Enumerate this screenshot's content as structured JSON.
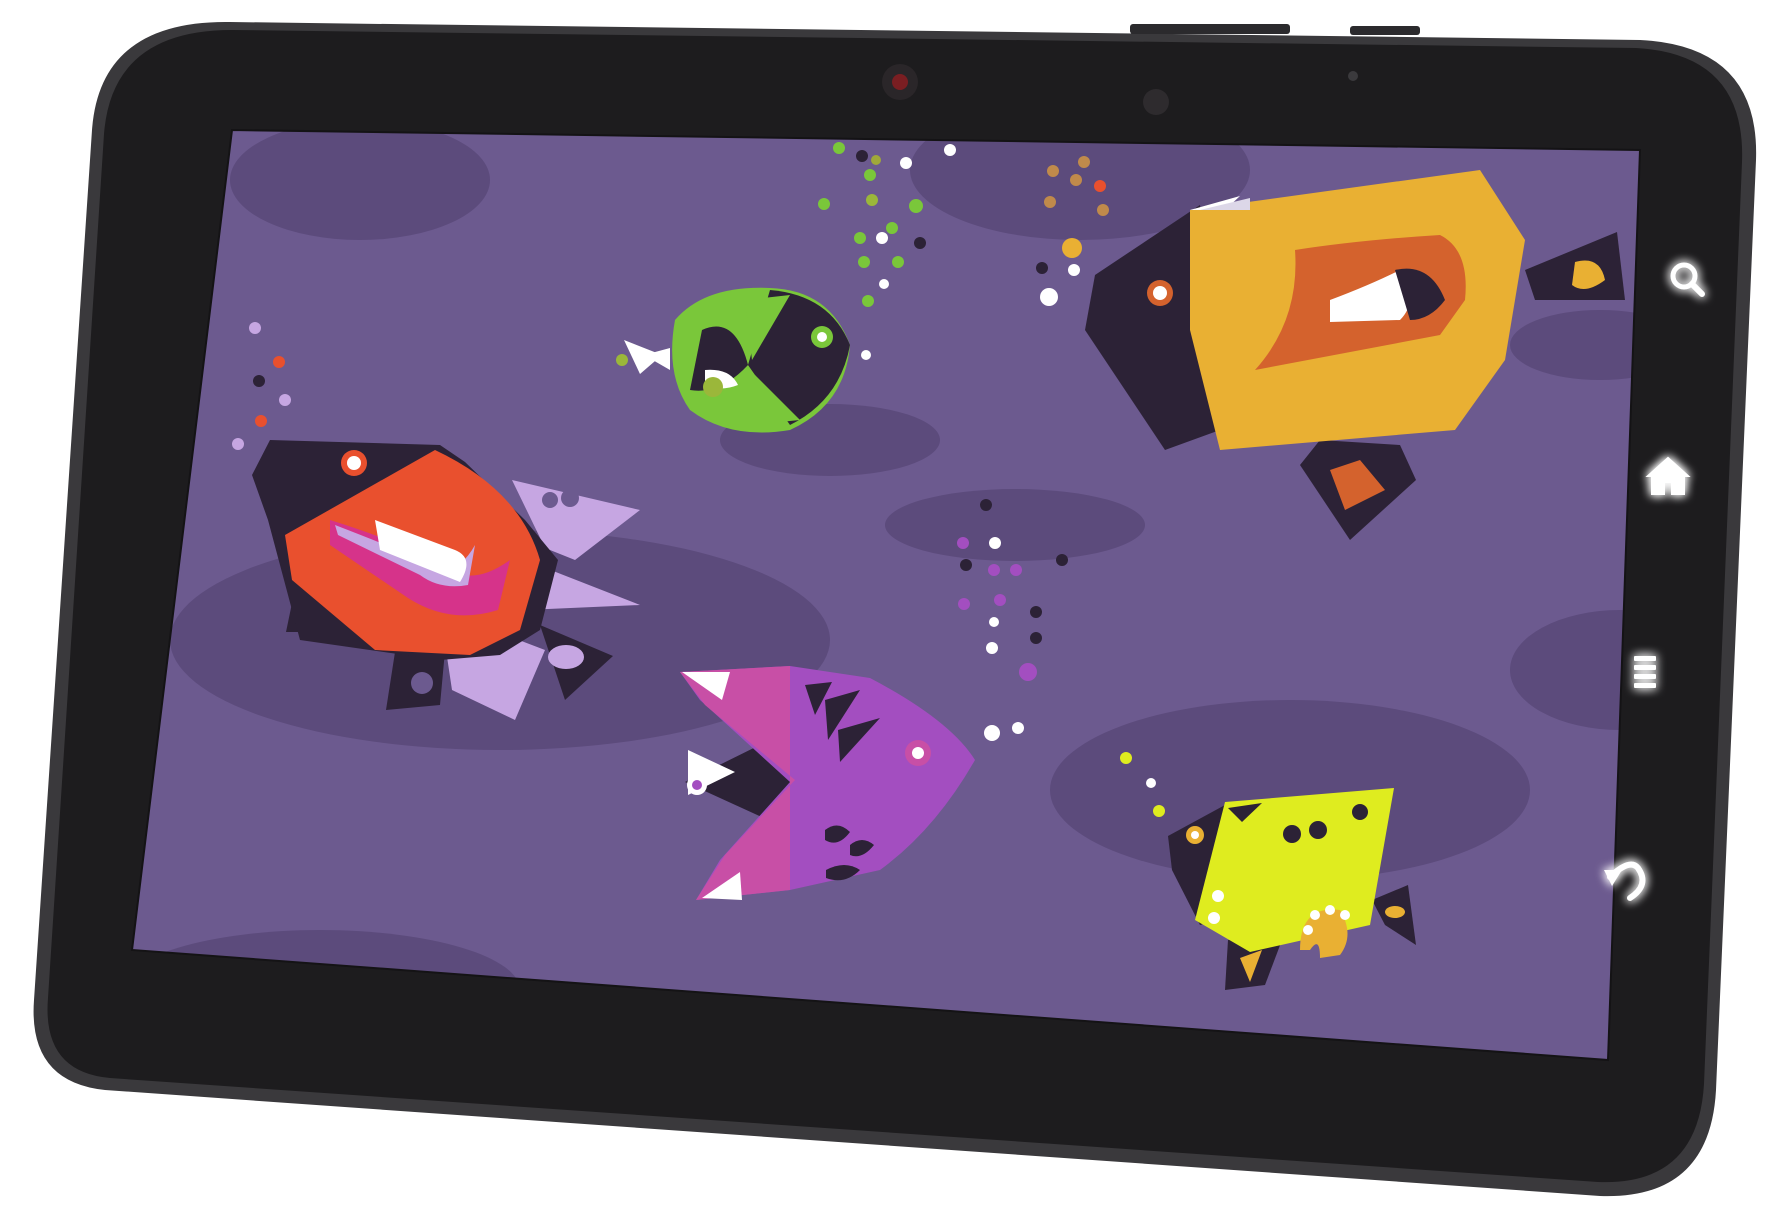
{
  "device": {
    "kind": "tablet",
    "bezel_color": "#1d1c1e",
    "rim_color": "#3a393c",
    "camera_color": "#2a2629",
    "camera_lens_color": "#7a1e22",
    "glow_color": "#ffffff"
  },
  "screen": {
    "background": "#6c5a8f",
    "shadow_color": "#5c4b7c",
    "wallpaper": "geometric-fish-aquarium"
  },
  "hardware_buttons": [
    {
      "name": "search-icon"
    },
    {
      "name": "home-icon"
    },
    {
      "name": "menu-icon"
    },
    {
      "name": "back-icon"
    }
  ],
  "palette": {
    "dark": "#2c2236",
    "red_orange": "#e9502e",
    "lilac": "#c6a6e2",
    "lime": "#7ac73a",
    "mustard": "#e9b033",
    "burnt_orange": "#d4622d",
    "magenta": "#c84fa6",
    "purple": "#a34ec0",
    "yellow_green": "#dfec1f",
    "white": "#ffffff"
  },
  "fish": [
    {
      "id": "red-fish",
      "body": "#e9502e",
      "accent": "#c6a6e2"
    },
    {
      "id": "green-fish",
      "body": "#7ac73a",
      "accent": "#2c2236"
    },
    {
      "id": "gold-fish",
      "body": "#e9b033",
      "accent": "#d4622d"
    },
    {
      "id": "magenta-fish",
      "body": "#c84fa6",
      "accent": "#a34ec0"
    },
    {
      "id": "yellow-fish",
      "body": "#dfec1f",
      "accent": "#e9b033"
    }
  ]
}
